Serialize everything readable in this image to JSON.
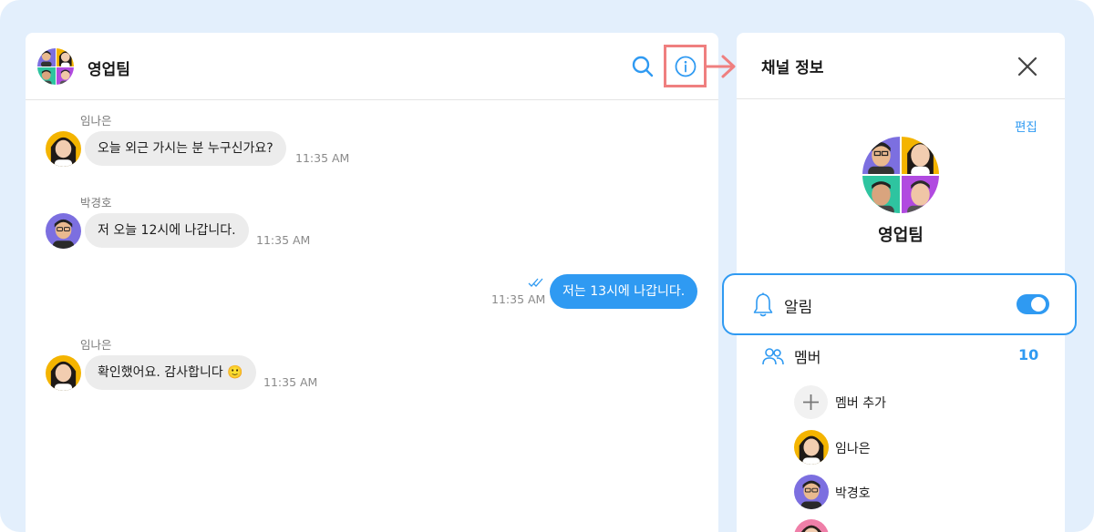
{
  "colors": {
    "accent": "#2f9af2",
    "background": "#e3effc",
    "highlight": "#ef7f7f",
    "bubble_other": "#ececec"
  },
  "chat": {
    "title": "영업팀",
    "header_icons": [
      "search-icon",
      "info-icon"
    ],
    "messages": [
      {
        "sender": "임나은",
        "text": "오늘 외근 가시는 분 누구신가요?",
        "time": "11:35 AM",
        "mine": false
      },
      {
        "sender": "박경호",
        "text": "저 오늘 12시에 나갑니다.",
        "time": "11:35 AM",
        "mine": false
      },
      {
        "sender": "",
        "text": "저는 13시에 나갑니다.",
        "time": "11:35 AM",
        "mine": true,
        "status_icon": "double-check-icon"
      },
      {
        "sender": "임나은",
        "text": "확인했어요. 감사합니다 🙂",
        "time": "11:35 AM",
        "mine": false
      }
    ]
  },
  "info_panel": {
    "title": "채널 정보",
    "close_icon": "close-icon",
    "edit_label": "편집",
    "channel_name": "영업팀",
    "notification": {
      "label": "알림",
      "enabled": true,
      "icon": "bell-icon"
    },
    "members": {
      "label": "멤버",
      "count": "10",
      "icon": "people-icon",
      "add_label": "멤버 추가",
      "list": [
        "임나은",
        "박경호"
      ]
    }
  }
}
